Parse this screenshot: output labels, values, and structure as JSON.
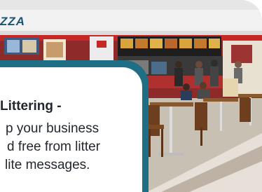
{
  "photo": {
    "sign_text": "ZZA"
  },
  "panel": {
    "heading": "Littering -",
    "lines": [
      "p your business",
      "d free from litter",
      "lite messages."
    ]
  },
  "colors": {
    "teal_frame": "#1e6f86",
    "heading_text": "#22272e",
    "sign_text": "#1a5575"
  }
}
